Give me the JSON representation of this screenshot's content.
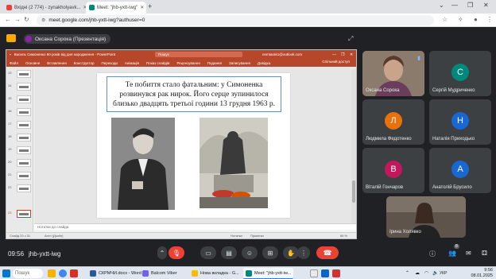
{
  "browser": {
    "tabs": [
      {
        "label": "Вхідні (2 774) - zynakholyavk...",
        "icon": "gmail-icon",
        "color": "#ea4335"
      },
      {
        "label": "Meet: \"jhb-yxtt-iwg\"",
        "icon": "meet-icon",
        "color": "#00897b"
      }
    ],
    "url": "meet.google.com/jhb-yxtt-iwg?authuser=0"
  },
  "meet": {
    "presenter_chip": "Оксана Сорока (Презентація)",
    "clock": "09:56",
    "meeting_code": "jhb-yxtt-iwg",
    "participants": [
      {
        "name": "Оксана Сорока",
        "initial": "",
        "color": "#c8a98a",
        "has_video": true
      },
      {
        "name": "Сергій Мудриченко",
        "initial": "С",
        "color": "#00897b",
        "has_video": false
      },
      {
        "name": "Людмила Федотенко",
        "initial": "Л",
        "color": "#e8710a",
        "has_video": false
      },
      {
        "name": "Наталія Приходько",
        "initial": "Н",
        "color": "#1967d2",
        "has_video": false
      },
      {
        "name": "Віталій Гончаров",
        "initial": "В",
        "color": "#c2185b",
        "has_video": false
      },
      {
        "name": "Анатолій Брусило",
        "initial": "А",
        "color": "#1967d2",
        "has_video": false
      },
      {
        "name": "Ірина Холявко",
        "initial": "",
        "color": "#6b5c52",
        "has_video": true
      }
    ],
    "participants_count": "8"
  },
  "powerpoint": {
    "title": "Василь Симоненко 90 років від дня народження - PowerPoint",
    "search": "Пошук",
    "user": "nnmtarak1@outlook.com",
    "ribbon_tabs": [
      "Файл",
      "Основне",
      "Вставлення",
      "Конструктор",
      "Переходи",
      "Анімація",
      "Показ слайдів",
      "Рецензування",
      "Подання",
      "Записування",
      "Довідка"
    ],
    "share": "Спільний доступ",
    "slide_text": "Те побиття стало фатальним: у Симоненка розвинувся рак нирок. Його серце зупинилося близько двадцять третьої години 13 грудня 1963 р.",
    "notes_placeholder": "Нотатки до слайда",
    "status_left": "Слайд 23 з 31",
    "status_lang": "Англ (Дьюїн)",
    "status_notes": "Нотатки",
    "status_comments": "Примітки",
    "zoom": "66 %",
    "thumb_numbers": [
      "13",
      "14",
      "15",
      "16",
      "17",
      "18",
      "19",
      "20",
      "21",
      "22",
      "23"
    ],
    "selected_thumb": "23"
  },
  "taskbar": {
    "search_placeholder": "Пошук",
    "apps": [
      {
        "label": "СКРМЧИ.docx - Word",
        "color": "#2b579a"
      },
      {
        "label": "Balcom Viber",
        "color": "#7360f2"
      },
      {
        "label": "Нова вкладка - G...",
        "color": "#fbbc04"
      },
      {
        "label": "Meet: \"jhb-yxtt-iw...",
        "color": "#00897b"
      }
    ],
    "lang": "УКР",
    "time": "9:56",
    "date": "08.01.2025"
  }
}
